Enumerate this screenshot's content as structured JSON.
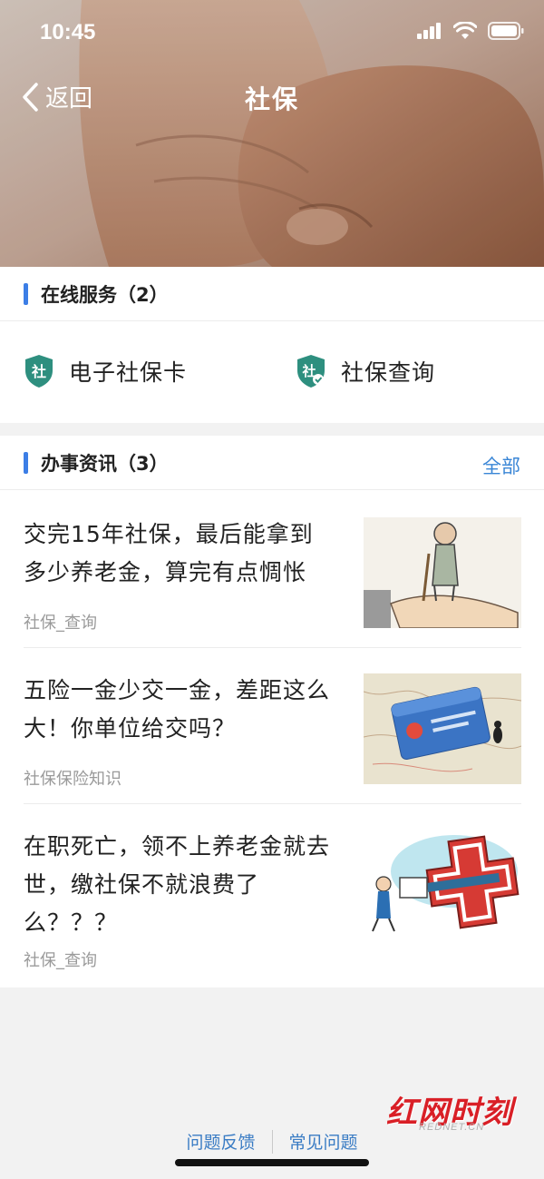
{
  "status_bar": {
    "time": "10:45"
  },
  "nav": {
    "back_label": "返回",
    "title": "社保"
  },
  "online_services": {
    "title": "在线服务（2）",
    "items": [
      {
        "label": "电子社保卡",
        "icon": "shield-she-icon",
        "badge_text": "社"
      },
      {
        "label": "社保查询",
        "icon": "shield-she-check-icon",
        "badge_text": "社"
      }
    ]
  },
  "news": {
    "title": "办事资讯（3）",
    "more_label": "全部",
    "items": [
      {
        "title": "交完15年社保，最后能拿到多少养老金，算完有点惆怅",
        "source": "社保_查询",
        "thumb": "elderly-man-on-hand-illustration"
      },
      {
        "title": "五险一金少交一金，差距这么大！你单位给交吗？",
        "source": "社保保险知识",
        "thumb": "social-security-card-on-map"
      },
      {
        "title": "在职死亡，领不上养老金就去世，缴社保不就浪费了么？？？",
        "source": "社保_查询",
        "thumb": "medical-cross-cartoon"
      }
    ]
  },
  "footer": {
    "feedback_label": "问题反馈",
    "faq_label": "常见问题"
  },
  "watermark": {
    "brand": "红网时刻",
    "domain": "REDNET.CN"
  },
  "colors": {
    "accent": "#3c7ee6",
    "link": "#3a86d6",
    "brand_red": "#d91f26"
  }
}
